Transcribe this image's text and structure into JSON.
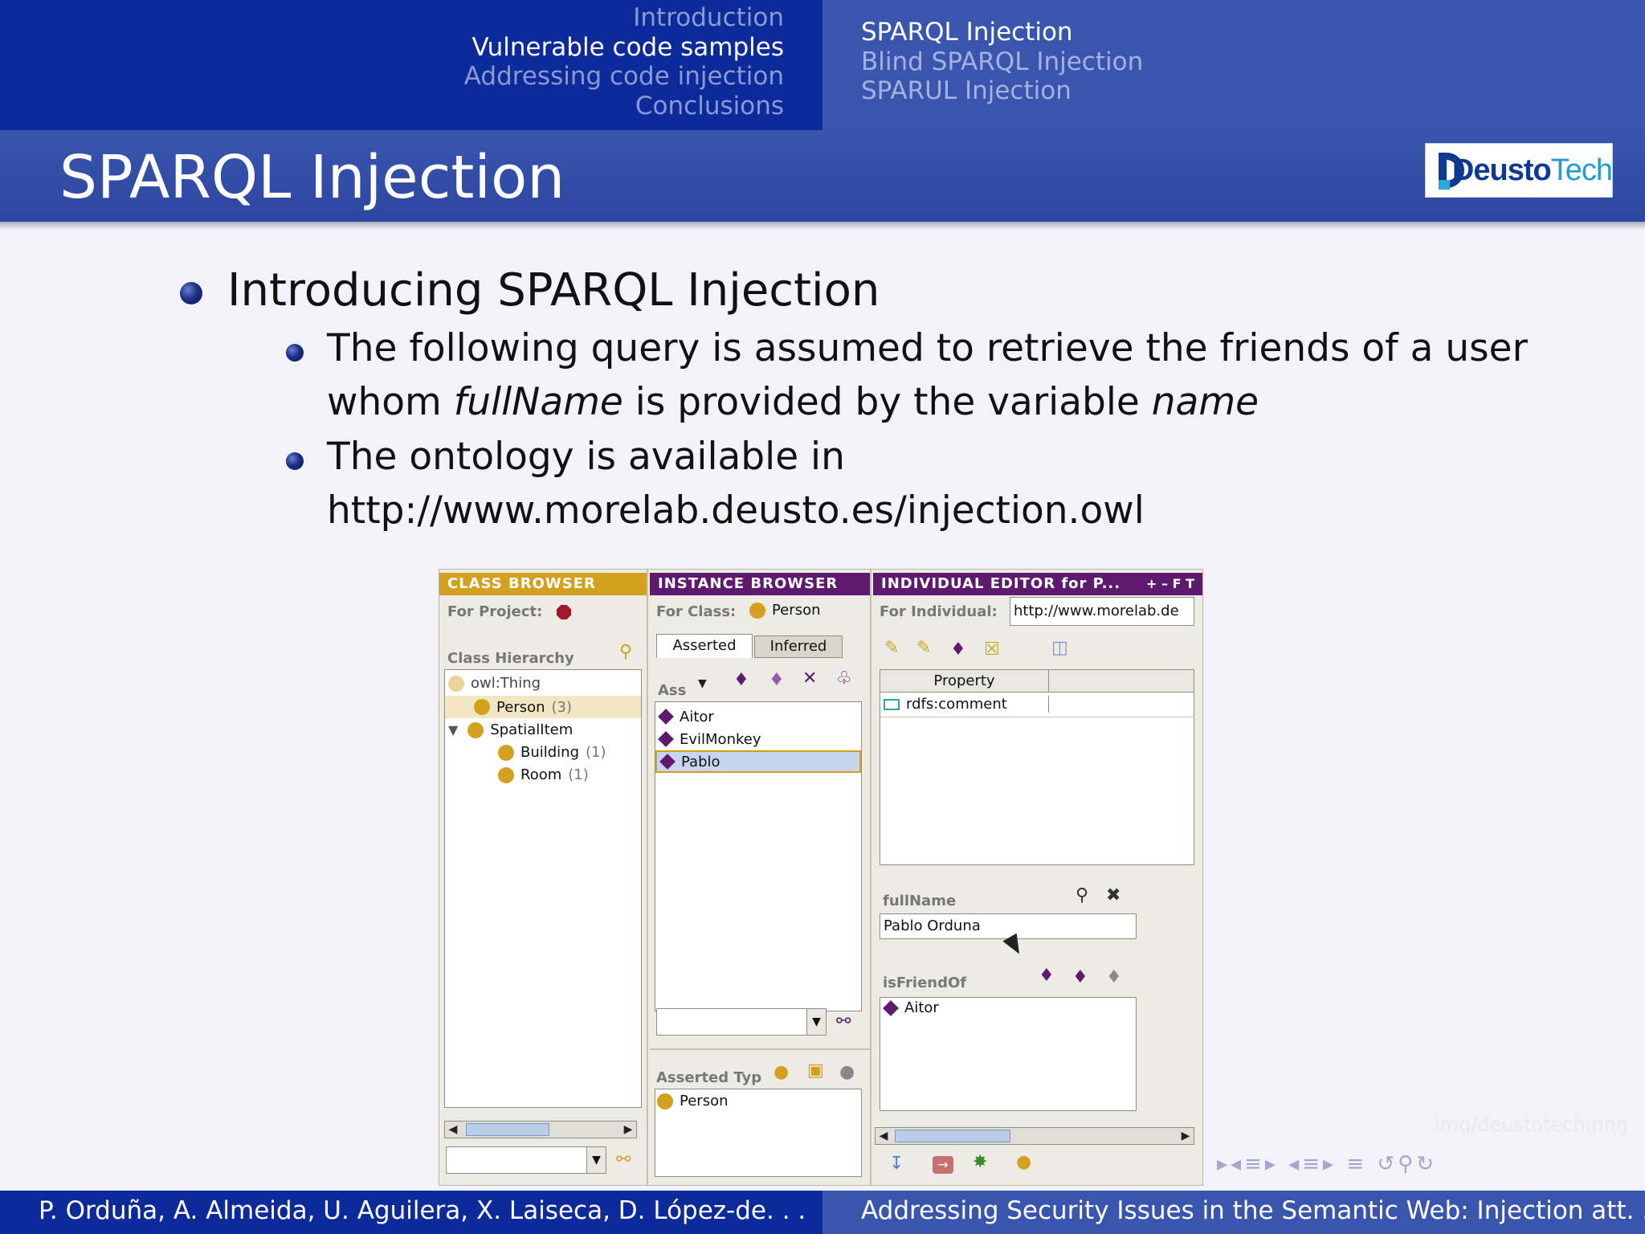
{
  "header": {
    "sections": [
      "Introduction",
      "Vulnerable code samples",
      "Addressing code injection",
      "Conclusions"
    ],
    "active_section": 1,
    "subsections": [
      "SPARQL Injection",
      "Blind SPARQL Injection",
      "SPARUL Injection"
    ],
    "active_subsection": 0
  },
  "frame_title": "SPARQL Injection",
  "logo": {
    "bold": "Deusto",
    "light": "Tech"
  },
  "content": {
    "bullet1": "Introducing SPARQL Injection",
    "sub1_line1": "The following query is assumed to retrieve the friends of a user",
    "sub1_line2_a": "whom ",
    "sub1_line2_b": "fullName",
    "sub1_line2_c": " is provided by the variable ",
    "sub1_line2_d": "name",
    "sub2_line1": "The ontology is available in",
    "sub2_line2": "http://www.morelab.deusto.es/injection.owl"
  },
  "protege": {
    "class_browser": {
      "title": "CLASS BROWSER",
      "for_project": "For Project:",
      "hierarchy_label": "Class Hierarchy",
      "items": [
        {
          "name": "owl:Thing",
          "count": ""
        },
        {
          "name": "Person",
          "count": "(3)"
        },
        {
          "name": "SpatialItem",
          "count": ""
        },
        {
          "name": "Building",
          "count": "(1)"
        },
        {
          "name": "Room",
          "count": "(1)"
        }
      ]
    },
    "instance_browser": {
      "title": "INSTANCE BROWSER",
      "for_class": "For Class:",
      "class_name": "Person",
      "tab_asserted": "Asserted",
      "tab_inferred": "Inferred",
      "asserted_short": "Ass",
      "instances": [
        "Aitor",
        "EvilMonkey",
        "Pablo"
      ],
      "selected_instance": "Pablo",
      "asserted_types_label": "Asserted Typ",
      "asserted_types": [
        "Person"
      ]
    },
    "individual_editor": {
      "title": "INDIVIDUAL EDITOR for P...",
      "title_buttons": "+ – F T",
      "for_individual": "For Individual:",
      "individual_uri": "http://www.morelab.de",
      "property_header": "Property",
      "properties": [
        "rdfs:comment"
      ],
      "fullname_label": "fullName",
      "fullname_value": "Pablo Orduna",
      "isfriendof_label": "isFriendOf",
      "friends": [
        "Aitor"
      ]
    }
  },
  "watermark": "img/deustotech.png",
  "footer": {
    "authors": "P. Orduña, A. Almeida, U. Aguilera, X. Laiseca, D. López-de. . .",
    "title": "Addressing Security Issues in the Semantic Web: Injection att. . ."
  },
  "colors": {
    "header_dark": "#0c2a99",
    "header_light": "#3a55ad",
    "class_browser_head": "#d4a11e",
    "instance_browser_head": "#5e1a6e",
    "selection": "#c7d6ee"
  }
}
